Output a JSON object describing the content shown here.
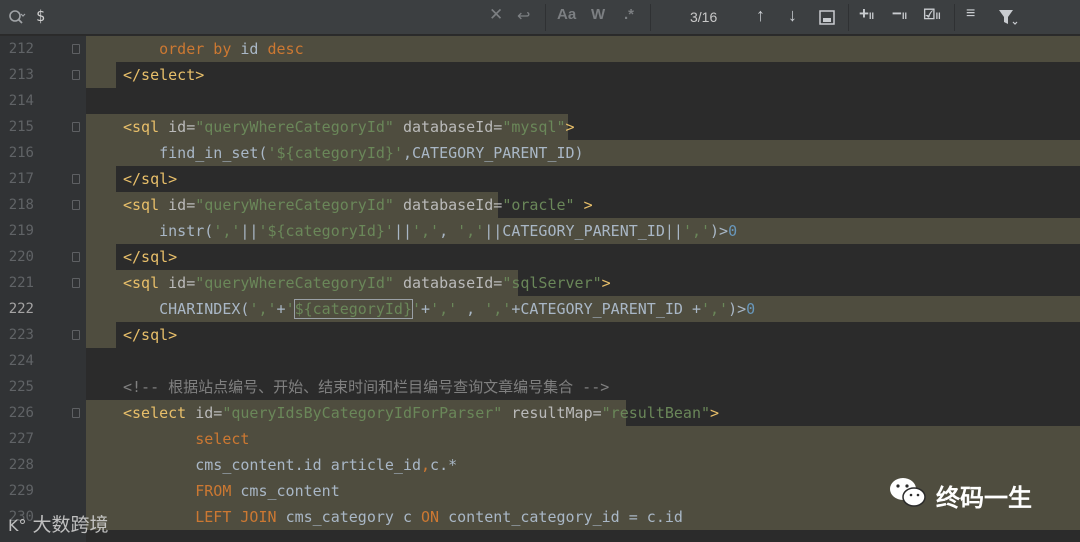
{
  "find_bar": {
    "query": "$",
    "match_count": "3/16",
    "match_case_label": "Aa",
    "words_label": "W",
    "regex_label": ".*"
  },
  "lines": [
    {
      "num": "212",
      "segs": [
        {
          "t": "    order by ",
          "c": "kw"
        },
        {
          "t": "id ",
          "c": "plain"
        },
        {
          "t": "desc",
          "c": "kw"
        }
      ]
    },
    {
      "num": "213",
      "segs": [
        {
          "t": "</select>",
          "c": "tag"
        }
      ]
    },
    {
      "num": "214",
      "segs": []
    },
    {
      "num": "215",
      "segs": [
        {
          "t": "<sql ",
          "c": "tag"
        },
        {
          "t": "id=",
          "c": "attr"
        },
        {
          "t": "\"queryWhereCategoryId\"",
          "c": "str"
        },
        {
          "t": " databaseId=",
          "c": "attr"
        },
        {
          "t": "\"mysql\"",
          "c": "str"
        },
        {
          "t": ">",
          "c": "tag"
        }
      ]
    },
    {
      "num": "216",
      "segs": [
        {
          "t": "    find_in_set(",
          "c": "plain"
        },
        {
          "t": "'",
          "c": "str"
        },
        {
          "t": "${categoryId}",
          "c": "var"
        },
        {
          "t": "'",
          "c": "str"
        },
        {
          "t": ",CATEGORY_PARENT_ID)",
          "c": "plain"
        }
      ]
    },
    {
      "num": "217",
      "segs": [
        {
          "t": "</sql>",
          "c": "tag"
        }
      ]
    },
    {
      "num": "218",
      "segs": [
        {
          "t": "<sql ",
          "c": "tag"
        },
        {
          "t": "id=",
          "c": "attr"
        },
        {
          "t": "\"queryWhereCategoryId\"",
          "c": "str"
        },
        {
          "t": " databaseId=",
          "c": "attr"
        },
        {
          "t": "\"oracle\"",
          "c": "str"
        },
        {
          "t": " >",
          "c": "tag"
        }
      ]
    },
    {
      "num": "219",
      "segs": [
        {
          "t": "    instr(",
          "c": "plain"
        },
        {
          "t": "','",
          "c": "str"
        },
        {
          "t": "||",
          "c": "plain"
        },
        {
          "t": "'",
          "c": "str"
        },
        {
          "t": "${categoryId}",
          "c": "var"
        },
        {
          "t": "'",
          "c": "str"
        },
        {
          "t": "||",
          "c": "plain"
        },
        {
          "t": "','",
          "c": "str"
        },
        {
          "t": ", ",
          "c": "plain"
        },
        {
          "t": "','",
          "c": "str"
        },
        {
          "t": "||CATEGORY_PARENT_ID||",
          "c": "plain"
        },
        {
          "t": "','",
          "c": "str"
        },
        {
          "t": ")>",
          "c": "plain"
        },
        {
          "t": "0",
          "c": "num"
        }
      ]
    },
    {
      "num": "220",
      "segs": [
        {
          "t": "</sql>",
          "c": "tag"
        }
      ]
    },
    {
      "num": "221",
      "segs": [
        {
          "t": "<sql ",
          "c": "tag"
        },
        {
          "t": "id=",
          "c": "attr"
        },
        {
          "t": "\"queryWhereCategoryId\"",
          "c": "str"
        },
        {
          "t": " databaseId=",
          "c": "attr"
        },
        {
          "t": "\"sqlServer\"",
          "c": "str"
        },
        {
          "t": ">",
          "c": "tag"
        }
      ]
    },
    {
      "num": "222",
      "segs": [
        {
          "t": "    CHARINDEX(",
          "c": "plain"
        },
        {
          "t": "','",
          "c": "str"
        },
        {
          "t": "+",
          "c": "plain"
        },
        {
          "t": "'",
          "c": "str"
        },
        {
          "t": "${categoryId}",
          "c": "var",
          "box": true
        },
        {
          "t": "'",
          "c": "str"
        },
        {
          "t": "+",
          "c": "plain"
        },
        {
          "t": "','",
          "c": "str"
        },
        {
          "t": " , ",
          "c": "plain"
        },
        {
          "t": "','",
          "c": "str"
        },
        {
          "t": "+CATEGORY_PARENT_ID +",
          "c": "plain"
        },
        {
          "t": "','",
          "c": "str"
        },
        {
          "t": ")>",
          "c": "plain"
        },
        {
          "t": "0",
          "c": "num"
        }
      ]
    },
    {
      "num": "223",
      "segs": [
        {
          "t": "</sql>",
          "c": "tag"
        }
      ]
    },
    {
      "num": "224",
      "segs": []
    },
    {
      "num": "225",
      "segs": [
        {
          "t": "<!-- 根据站点编号、开始、结束时间和栏目编号查询文章编号集合 -->",
          "c": "cmt"
        }
      ]
    },
    {
      "num": "226",
      "segs": [
        {
          "t": "<select ",
          "c": "tag"
        },
        {
          "t": "id=",
          "c": "attr"
        },
        {
          "t": "\"queryIdsByCategoryIdForParser\"",
          "c": "str"
        },
        {
          "t": " resultMap=",
          "c": "attr"
        },
        {
          "t": "\"resultBean\"",
          "c": "str"
        },
        {
          "t": ">",
          "c": "tag"
        }
      ]
    },
    {
      "num": "227",
      "segs": [
        {
          "t": "        select",
          "c": "kw"
        }
      ]
    },
    {
      "num": "228",
      "segs": [
        {
          "t": "        cms_content.id article_id",
          "c": "plain"
        },
        {
          "t": ",",
          "c": "kw"
        },
        {
          "t": "c.*",
          "c": "plain"
        }
      ]
    },
    {
      "num": "229",
      "segs": [
        {
          "t": "        FROM ",
          "c": "kw"
        },
        {
          "t": "cms_content",
          "c": "plain"
        }
      ]
    },
    {
      "num": "230",
      "segs": [
        {
          "t": "        LEFT JOIN ",
          "c": "kw"
        },
        {
          "t": "cms_category c ",
          "c": "plain"
        },
        {
          "t": "ON ",
          "c": "kw"
        },
        {
          "t": "content_category_id = c.id",
          "c": "plain"
        }
      ]
    }
  ],
  "watermark": {
    "left_text": "大数跨境",
    "right_text": "终码一生"
  }
}
